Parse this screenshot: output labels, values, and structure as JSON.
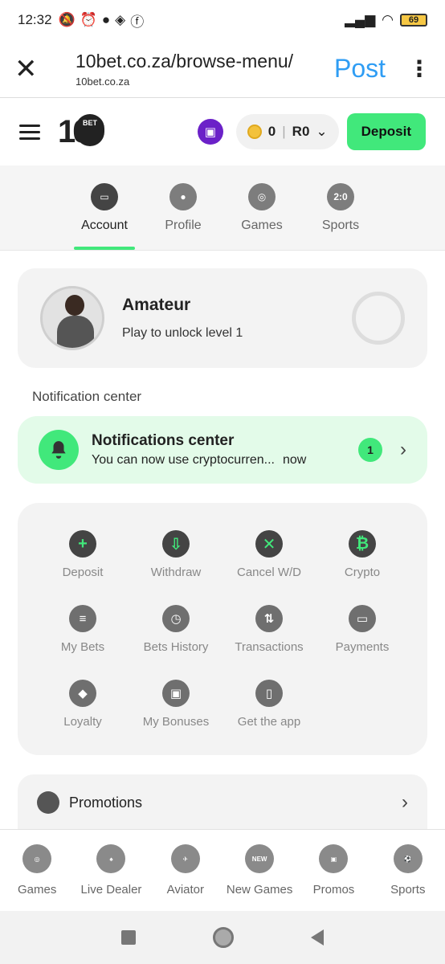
{
  "status_bar": {
    "time": "12:32",
    "battery": "69"
  },
  "browser": {
    "close_icon": "close-icon",
    "url": "10bet.co.za/browse-menu/",
    "host": "10bet.co.za",
    "post_label": "Post"
  },
  "header": {
    "logo_text": "10",
    "logo_disc": "BET",
    "wallet_coins": "0",
    "wallet_balance": "R0",
    "deposit_label": "Deposit"
  },
  "tabs": [
    {
      "label": "Account",
      "icon": "wallet-icon",
      "active": true
    },
    {
      "label": "Profile",
      "icon": "user-icon",
      "active": false
    },
    {
      "label": "Games",
      "icon": "chip-icon",
      "active": false
    },
    {
      "label": "Sports",
      "icon": "scoreboard-icon",
      "glyph": "2:0",
      "active": false
    }
  ],
  "level": {
    "title": "Amateur",
    "subtitle": "Play to unlock level 1",
    "progress": 0
  },
  "notification_section": "Notification center",
  "notification": {
    "title": "Notifications center",
    "message": "You can now use cryptocurren...",
    "time": "now",
    "count": "1"
  },
  "actions": [
    {
      "label": "Deposit",
      "icon": "plus-icon",
      "glyph": "+"
    },
    {
      "label": "Withdraw",
      "icon": "withdraw-icon",
      "glyph": "⇩"
    },
    {
      "label": "Cancel W/D",
      "icon": "cancel-withdraw-icon",
      "glyph": "✕"
    },
    {
      "label": "Crypto",
      "icon": "bitcoin-icon",
      "glyph": "₿"
    },
    {
      "label": "My Bets",
      "icon": "receipt-icon",
      "glyph": "≡"
    },
    {
      "label": "Bets History",
      "icon": "history-icon",
      "glyph": "◷"
    },
    {
      "label": "Transactions",
      "icon": "transfer-icon",
      "glyph": "⇅"
    },
    {
      "label": "Payments",
      "icon": "card-icon",
      "glyph": "▭"
    },
    {
      "label": "Loyalty",
      "icon": "diamond-icon",
      "glyph": "◆"
    },
    {
      "label": "My Bonuses",
      "icon": "gift-icon",
      "glyph": "🎁"
    },
    {
      "label": "Get the app",
      "icon": "phone-icon",
      "glyph": "▯"
    }
  ],
  "promotions_label": "Promotions",
  "bottom_nav": [
    {
      "label": "Games",
      "icon": "chip-icon",
      "glyph": ""
    },
    {
      "label": "Live Dealer",
      "icon": "dealer-icon",
      "glyph": ""
    },
    {
      "label": "Aviator",
      "icon": "plane-icon",
      "glyph": ""
    },
    {
      "label": "New Games",
      "icon": "new-badge-icon",
      "glyph": "NEW"
    },
    {
      "label": "Promos",
      "icon": "gift-icon",
      "glyph": ""
    },
    {
      "label": "Sports",
      "icon": "soccer-ball-icon",
      "glyph": ""
    }
  ],
  "colors": {
    "accent": "#41e87b",
    "gift_badge": "#6b21c8",
    "post_link": "#2f9df4"
  }
}
